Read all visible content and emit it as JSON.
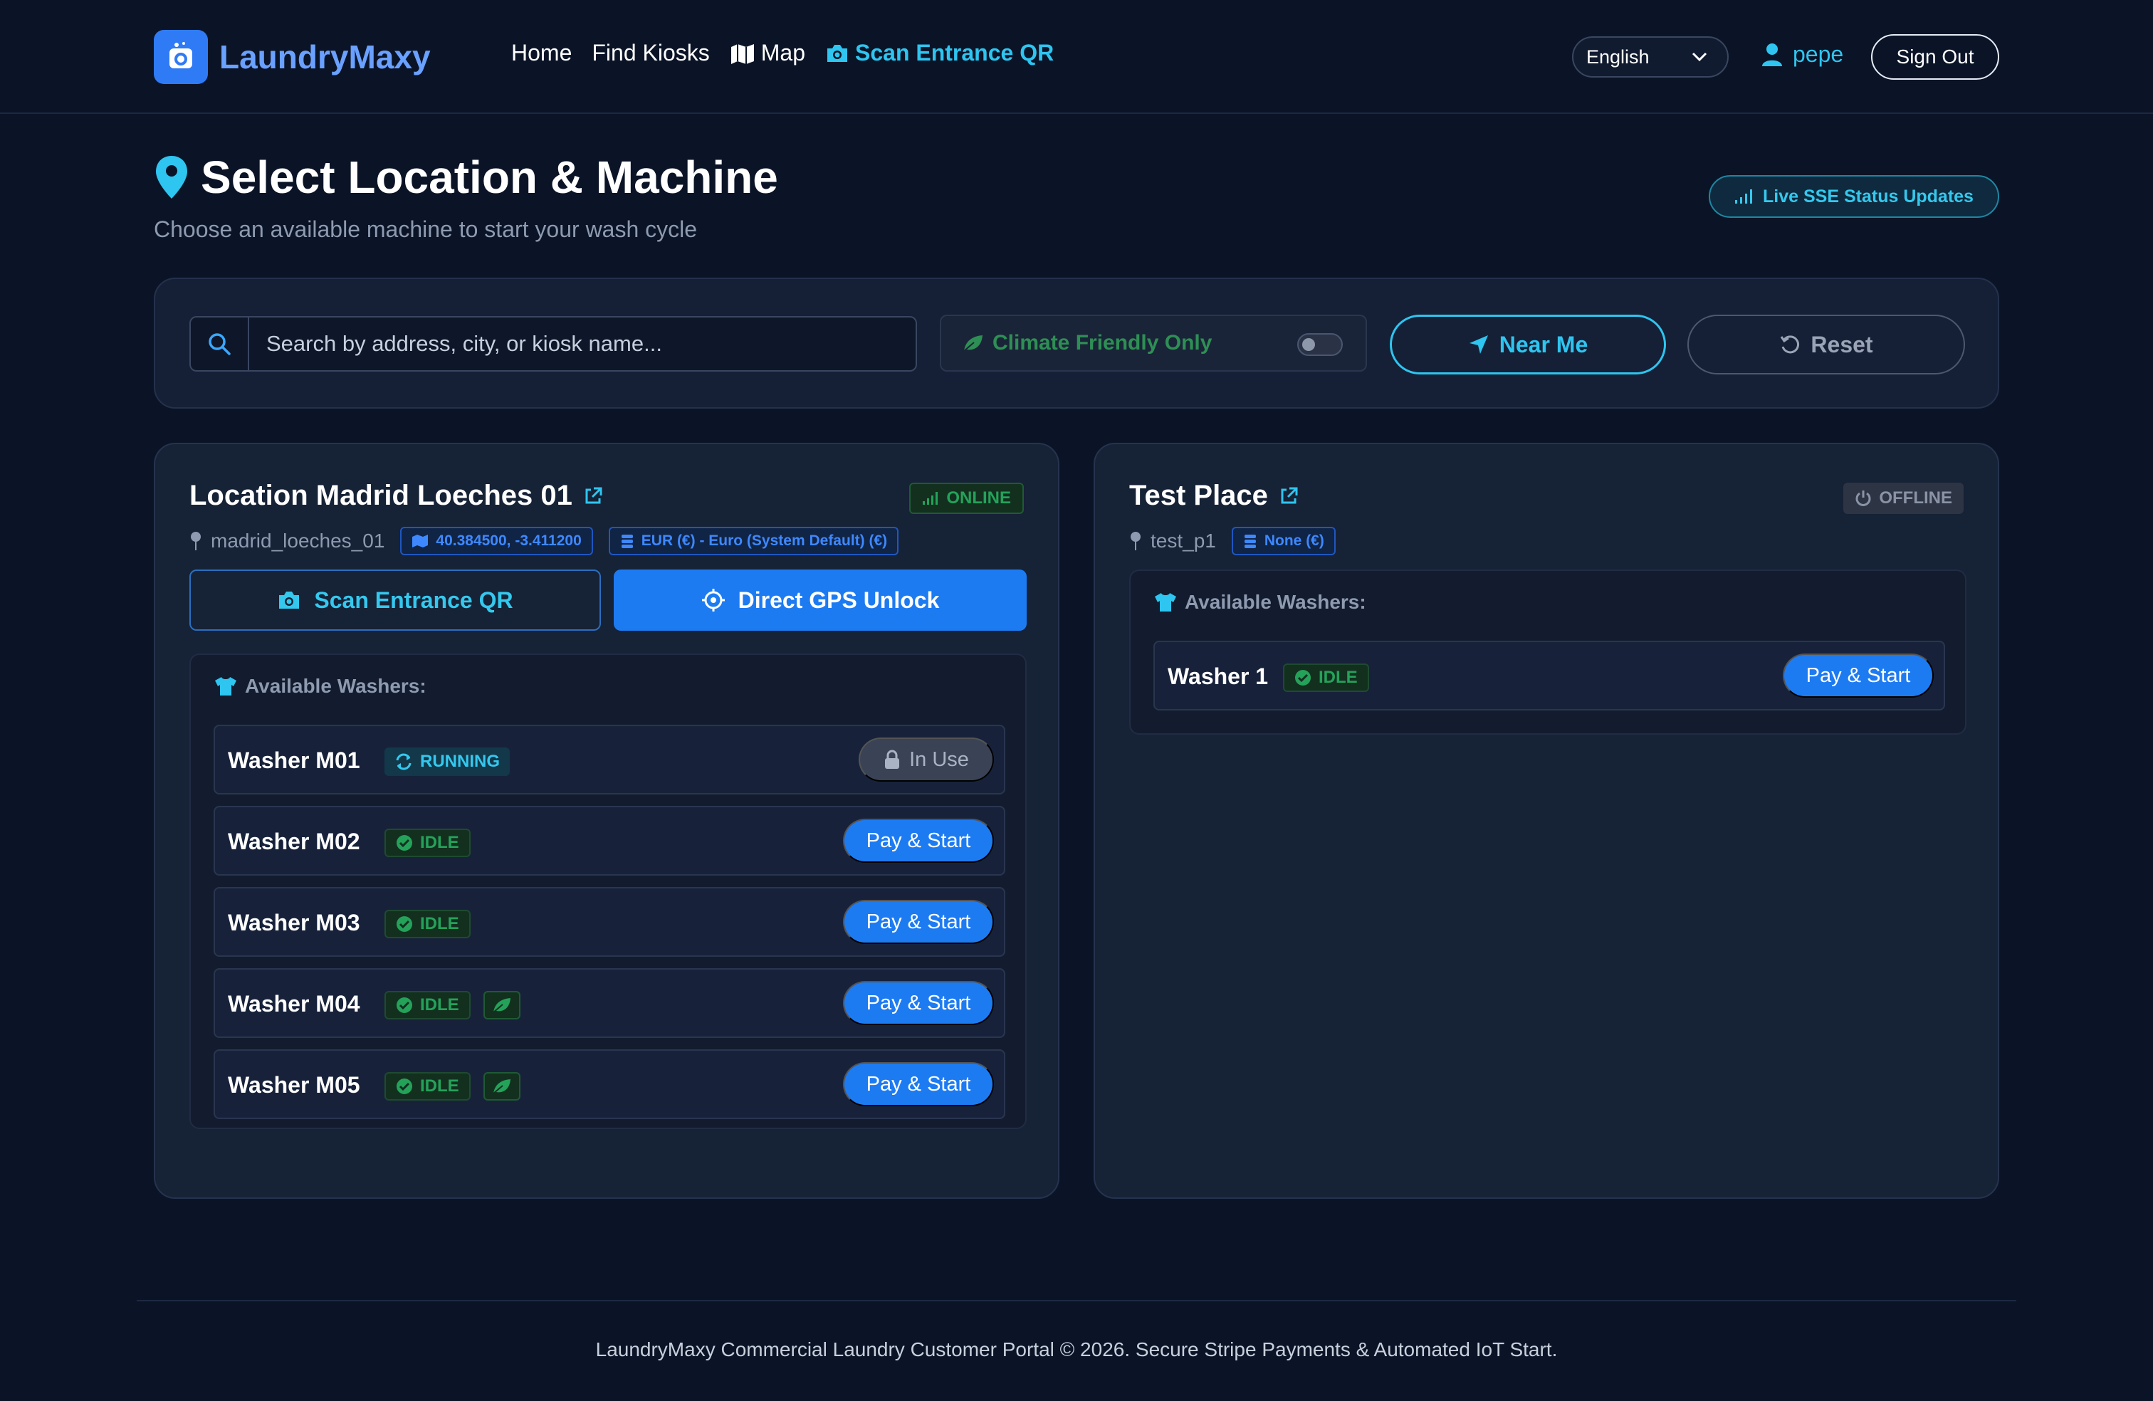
{
  "nav": {
    "brand": "LaundryMaxy",
    "links": [
      "Home",
      "Find Kiosks",
      "Map",
      "Scan Entrance QR"
    ],
    "language": "English",
    "user": "pepe",
    "signout": "Sign Out"
  },
  "page": {
    "title": "Select Location & Machine",
    "subtitle": "Choose an available machine to start your wash cycle",
    "live_badge": "Live SSE Status Updates"
  },
  "filters": {
    "search_placeholder": "Search by address, city, or kiosk name...",
    "search_value": "",
    "climate_label": "Climate Friendly Only",
    "climate_enabled": false,
    "near_me": "Near Me",
    "reset": "Reset"
  },
  "locations": [
    {
      "name": "Location Madrid Loeches 01",
      "status": "ONLINE",
      "id": "madrid_loeches_01",
      "coords": "40.384500, -3.411200",
      "currency": "EUR (€) - Euro (System Default) (€)",
      "scan_btn": "Scan Entrance QR",
      "gps_btn": "Direct GPS Unlock",
      "washers_heading": "Available Washers:",
      "washers": [
        {
          "name": "Washer M01",
          "status": "RUNNING",
          "eco": false,
          "action": "In Use"
        },
        {
          "name": "Washer M02",
          "status": "IDLE",
          "eco": false,
          "action": "Pay & Start"
        },
        {
          "name": "Washer M03",
          "status": "IDLE",
          "eco": false,
          "action": "Pay & Start"
        },
        {
          "name": "Washer M04",
          "status": "IDLE",
          "eco": true,
          "action": "Pay & Start"
        },
        {
          "name": "Washer M05",
          "status": "IDLE",
          "eco": true,
          "action": "Pay & Start"
        }
      ]
    },
    {
      "name": "Test Place",
      "status": "OFFLINE",
      "id": "test_p1",
      "currency": "None (€)",
      "washers_heading": "Available Washers:",
      "washers": [
        {
          "name": "Washer 1",
          "status": "IDLE",
          "eco": false,
          "action": "Pay & Start"
        }
      ]
    }
  ],
  "footer": "LaundryMaxy Commercial Laundry Customer Portal © 2026. Secure Stripe Payments & Automated IoT Start.",
  "colors": {
    "background": "#0b1427",
    "accent": "#2ec5f0",
    "primary": "#1d7bf2",
    "online": "#25a25a",
    "offline": "#8a93a6"
  }
}
